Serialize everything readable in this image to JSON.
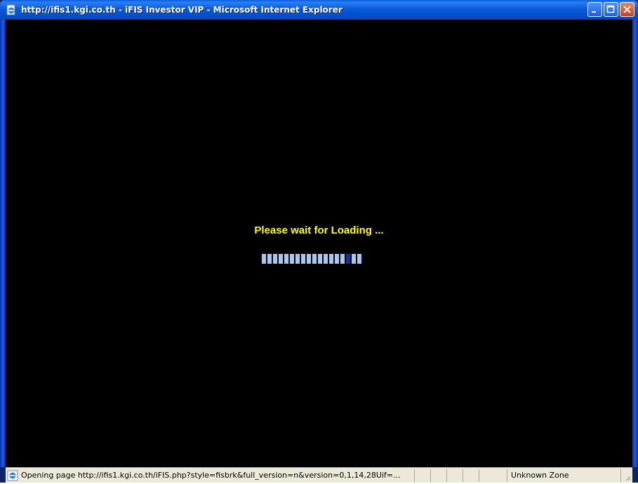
{
  "window": {
    "title": "http://ifis1.kgi.co.th - iFIS Investor VIP - Microsoft Internet Explorer",
    "icon": "ie-page-icon",
    "controls": [
      "minimize-icon",
      "maximize-icon",
      "close-icon"
    ]
  },
  "content": {
    "loading_text": "Please wait for Loading ...",
    "progress": {
      "segments": 18,
      "active_index": 15
    }
  },
  "statusbar": {
    "text": "Opening page http://ifis1.kgi.co.th/iFIS.php?style=fisbrk&full_version=n&version=0,1,14,28Uif=...",
    "zone": "Unknown Zone"
  },
  "colors": {
    "title_bar": "#0b5ad8",
    "content_bg": "#000000",
    "loading_text": "#ffff00",
    "progress_segment": "#a6c8f0",
    "progress_active": "#1b2fa0",
    "statusbar_bg": "#ece9d8"
  }
}
